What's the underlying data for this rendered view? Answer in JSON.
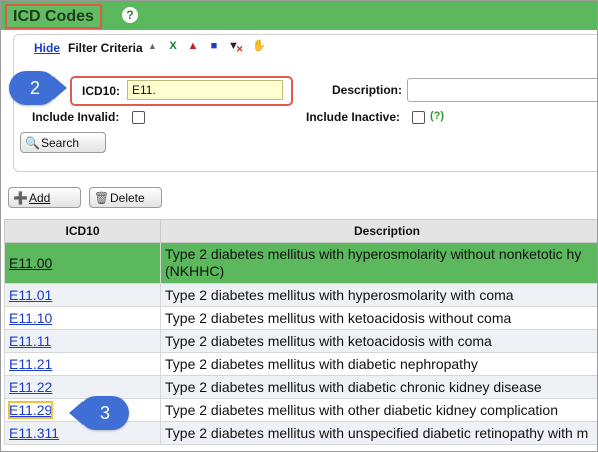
{
  "title": "ICD Codes",
  "help_icon": "?",
  "filter": {
    "hide_label": "Hide",
    "criteria_label": "Filter Criteria",
    "toolbar_icons": [
      "excel-icon",
      "pdf-icon",
      "save-icon",
      "clear-filter-icon",
      "hand-icon"
    ],
    "icd_label": "ICD10:",
    "icd_value": "E11.",
    "description_label": "Description:",
    "description_value": "",
    "include_invalid_label": "Include Invalid:",
    "include_inactive_label": "Include Inactive:",
    "inactive_help": "(?)",
    "search_label": "Search"
  },
  "actions": {
    "add_label": "Add",
    "delete_label": "Delete"
  },
  "callouts": {
    "step2": "2",
    "step3": "3"
  },
  "colors": {
    "header_green": "#5cb85c",
    "callout_blue": "#3f6fd4",
    "highlight_red": "#e05a4f"
  },
  "table": {
    "columns": [
      "ICD10",
      "Description"
    ],
    "rows": [
      {
        "code": "E11.00",
        "description": "Type 2 diabetes mellitus with hyperosmolarity without nonketotic hy",
        "description_line2": "(NKHHC)",
        "selected": true
      },
      {
        "code": "E11.01",
        "description": "Type 2 diabetes mellitus with hyperosmolarity with coma"
      },
      {
        "code": "E11.10",
        "description": "Type 2 diabetes mellitus with ketoacidosis without coma"
      },
      {
        "code": "E11.11",
        "description": "Type 2 diabetes mellitus with ketoacidosis with coma"
      },
      {
        "code": "E11.21",
        "description": "Type 2 diabetes mellitus with diabetic nephropathy"
      },
      {
        "code": "E11.22",
        "description": "Type 2 diabetes mellitus with diabetic chronic kidney disease"
      },
      {
        "code": "E11.29",
        "description": "Type 2 diabetes mellitus with other diabetic kidney complication"
      },
      {
        "code": "E11.311",
        "description": "Type 2 diabetes mellitus with unspecified diabetic retinopathy with m"
      }
    ]
  }
}
